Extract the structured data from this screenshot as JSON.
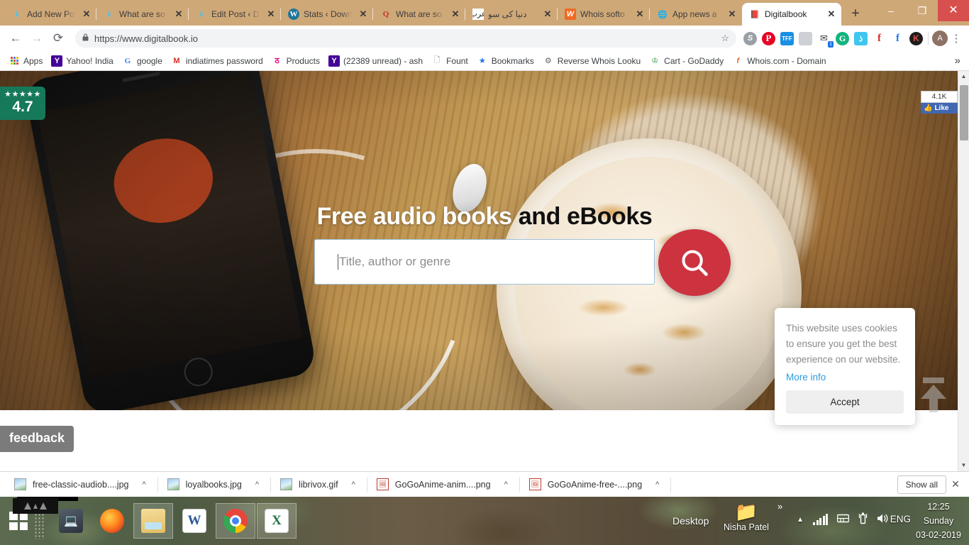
{
  "browser": {
    "tabs": [
      {
        "title": "Add New Po",
        "icon": "download-icon",
        "icon_kind": "dl",
        "active": false
      },
      {
        "title": "What are so",
        "icon": "download-icon",
        "icon_kind": "dl",
        "active": false
      },
      {
        "title": "Edit Post ‹ D",
        "icon": "download-icon",
        "icon_kind": "dl",
        "active": false
      },
      {
        "title": "Stats ‹ Down",
        "icon": "wordpress-icon",
        "icon_kind": "wp",
        "active": false
      },
      {
        "title": "What are so",
        "icon": "quora-icon",
        "icon_kind": "q",
        "active": false
      },
      {
        "title": "دنیا کی سو",
        "icon": "arabic-site-icon",
        "icon_kind": "ar",
        "active": false
      },
      {
        "title": "Whois softo",
        "icon": "flame-icon",
        "icon_kind": "fl",
        "active": false
      },
      {
        "title": "App news a",
        "icon": "globe-icon",
        "icon_kind": "gl",
        "active": false
      },
      {
        "title": "Digitalbook",
        "icon": "book-icon",
        "icon_kind": "book",
        "active": true
      }
    ],
    "new_tab_label": "+",
    "window_controls": {
      "minimize": "–",
      "maximize": "❐",
      "close": "✕"
    },
    "nav": {
      "back": "←",
      "forward": "→",
      "reload": "⟳"
    },
    "omnibox": {
      "lock": "🔒",
      "url": "https://www.digitalbook.io",
      "bookmark_star": "☆"
    },
    "extensions": [
      {
        "name": "skype-extension-icon",
        "glyph": "S",
        "cls": "ei-skype"
      },
      {
        "name": "pinterest-extension-icon",
        "glyph": "P",
        "cls": "ei-pin"
      },
      {
        "name": "tff-extension-icon",
        "glyph": "TFF",
        "cls": "ei-tff"
      },
      {
        "name": "grey-extension-icon",
        "glyph": "",
        "cls": "ei-grey"
      },
      {
        "name": "mail-extension-icon",
        "glyph": "✉",
        "cls": "ei-mail",
        "badge": "1"
      },
      {
        "name": "grammarly-extension-icon",
        "glyph": "G",
        "cls": "ei-gram"
      },
      {
        "name": "blue-extension-icon",
        "glyph": "ذ",
        "cls": "ei-blue"
      },
      {
        "name": "facebook-red-extension-icon",
        "glyph": "f",
        "cls": "ei-f1"
      },
      {
        "name": "facebook-extension-icon",
        "glyph": "f",
        "cls": "ei-f2"
      },
      {
        "name": "k-extension-icon",
        "glyph": "K",
        "cls": "ei-k"
      }
    ],
    "profile_initial": "A",
    "menu_glyph": "⋮",
    "bookmarks": [
      {
        "label": "Apps",
        "icon": "apps-grid-icon",
        "kind": "apps"
      },
      {
        "label": "Yahoo! India",
        "icon": "yahoo-icon",
        "kind": "y",
        "glyph": "Y"
      },
      {
        "label": "google",
        "icon": "google-icon",
        "kind": "g",
        "glyph": "G"
      },
      {
        "label": "indiatimes password",
        "icon": "gmail-icon",
        "kind": "m",
        "glyph": "M"
      },
      {
        "label": "Products",
        "icon": "airtel-icon",
        "kind": "a",
        "glyph": "ठ"
      },
      {
        "label": "(22389 unread) - ash",
        "icon": "yahoo-icon",
        "kind": "y",
        "glyph": "Y"
      },
      {
        "label": "Fount",
        "icon": "page-icon",
        "kind": "doc",
        "glyph": "🗋"
      },
      {
        "label": "Bookmarks",
        "icon": "star-icon",
        "kind": "star",
        "glyph": "★"
      },
      {
        "label": "Reverse Whois Looku",
        "icon": "gear-icon",
        "kind": "gear",
        "glyph": "⚙"
      },
      {
        "label": "Cart - GoDaddy",
        "icon": "godaddy-icon",
        "kind": "god",
        "glyph": "♔"
      },
      {
        "label": "Whois.com - Domain",
        "icon": "flame-icon",
        "kind": "wf",
        "glyph": "f"
      }
    ],
    "bookmarks_overflow": "»",
    "page_scrollbar": {
      "up": "▲",
      "down": "▼"
    }
  },
  "page": {
    "rating": {
      "stars": "★★★★★",
      "score": "4.7"
    },
    "facebook": {
      "count": "4.1K",
      "like_label": "Like",
      "thumb": "👍"
    },
    "hero": {
      "title_white": "Free audio books",
      "title_black": " and eBooks",
      "search_placeholder": "Title, author or genre",
      "search_value": "",
      "search_button": "search-icon"
    },
    "cookie": {
      "text": "This website uses cookies to ensure you get the best experience on our website.",
      "more_info": "More info",
      "accept": "Accept"
    },
    "feedback_label": "feedback",
    "scroll_top": "scroll-to-top-icon"
  },
  "downloads": {
    "items": [
      {
        "name": "free-classic-audiob....jpg",
        "kind": "img"
      },
      {
        "name": "loyalbooks.jpg",
        "kind": "img"
      },
      {
        "name": "librivox.gif",
        "kind": "img"
      },
      {
        "name": "GoGoAnime-anim....png",
        "kind": "red"
      },
      {
        "name": "GoGoAnime-free-....png",
        "kind": "red"
      }
    ],
    "caret": "^",
    "show_all": "Show all",
    "close": "✕"
  },
  "taskbar": {
    "apps": [
      {
        "name": "remote-desktop-icon",
        "cls": "ic-laptop",
        "glyph": "💻",
        "boxed": false
      },
      {
        "name": "firefox-icon",
        "cls": "ic-ff",
        "glyph": "",
        "boxed": false
      },
      {
        "name": "file-explorer-icon",
        "cls": "ic-folder",
        "glyph": "",
        "boxed": true
      },
      {
        "name": "word-icon",
        "cls": "ic-word",
        "glyph": "W",
        "boxed": false
      },
      {
        "name": "chrome-icon",
        "cls": "ic-chrome",
        "glyph": "",
        "boxed": true
      },
      {
        "name": "excel-icon",
        "cls": "ic-excel",
        "glyph": "X",
        "boxed": true
      }
    ],
    "desktop_label": "Desktop",
    "user_folder": "Nisha Patel",
    "overflow": "»",
    "tray": {
      "show_hidden": "▲",
      "network": "signal-bars",
      "battery": "🔋",
      "volume": "🔊"
    },
    "language": "ENG",
    "clock": {
      "time": "12:25",
      "day": "Sunday",
      "date": "03-02-2019"
    }
  }
}
